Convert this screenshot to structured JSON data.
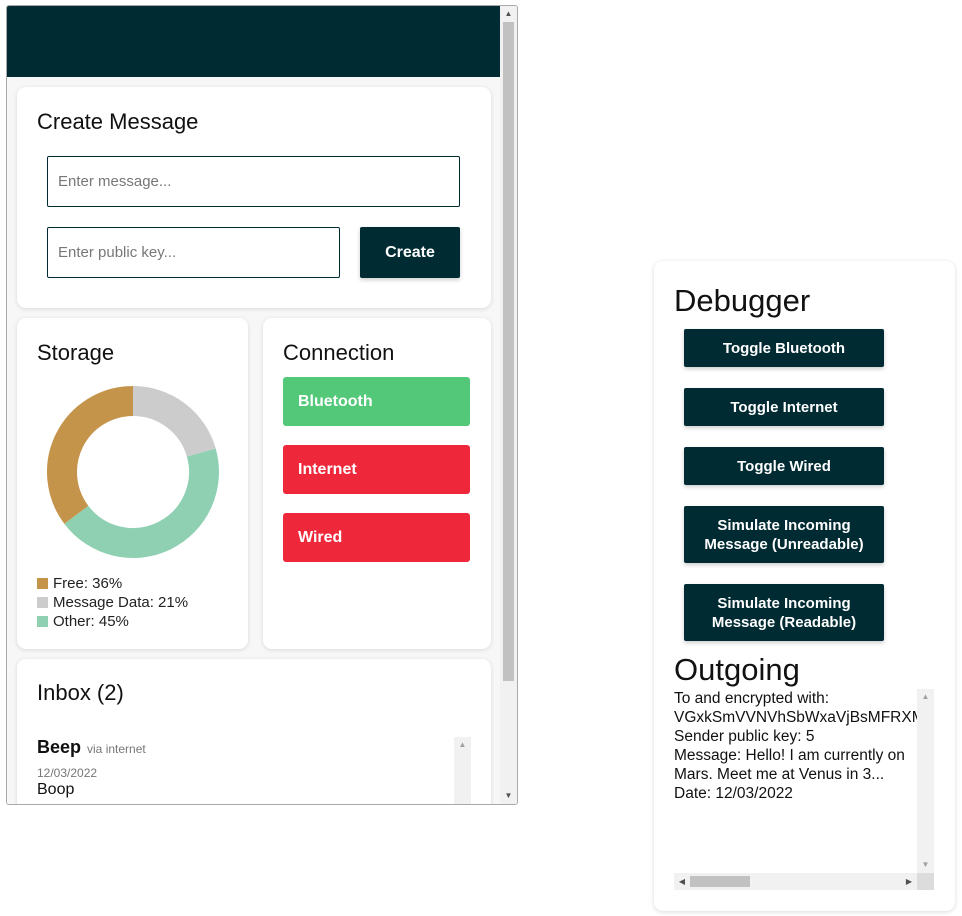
{
  "create_message": {
    "title": "Create Message",
    "message_placeholder": "Enter message...",
    "key_placeholder": "Enter public key...",
    "create_label": "Create"
  },
  "storage": {
    "title": "Storage",
    "legend": [
      {
        "label": "Free: 36%",
        "color": "#c4944a",
        "percent": 36
      },
      {
        "label": "Message Data: 21%",
        "color": "#cccccc",
        "percent": 21
      },
      {
        "label": "Other: 45%",
        "color": "#8fd0b3",
        "percent": 45
      }
    ]
  },
  "connection": {
    "title": "Connection",
    "bluetooth_label": "Bluetooth",
    "internet_label": "Internet",
    "wired_label": "Wired",
    "on_color": "#52c878",
    "off_color": "#ee273a"
  },
  "inbox": {
    "title": "Inbox (2)",
    "messages": [
      {
        "title": "Beep",
        "via": "via internet",
        "date": "12/03/2022",
        "body": "Boop"
      }
    ]
  },
  "debugger": {
    "title": "Debugger",
    "toggle_bluetooth": "Toggle Bluetooth",
    "toggle_internet": "Toggle Internet",
    "toggle_wired": "Toggle Wired",
    "simulate_unreadable_line1": "Simulate Incoming",
    "simulate_unreadable_line2": "Message (Unreadable)",
    "simulate_readable_line1": "Simulate Incoming",
    "simulate_readable_line2": "Message (Readable)"
  },
  "outgoing": {
    "title": "Outgoing",
    "lines": [
      "To and encrypted with:",
      "VGxkSmVVNVhSbWxaVjBsMFRXM",
      "Sender public key: 5",
      "Message: Hello! I am currently on",
      "Mars. Meet me at Venus in 3...",
      "Date: 12/03/2022"
    ]
  },
  "theme": {
    "header_color": "#002b33",
    "button_color": "#002b33"
  }
}
